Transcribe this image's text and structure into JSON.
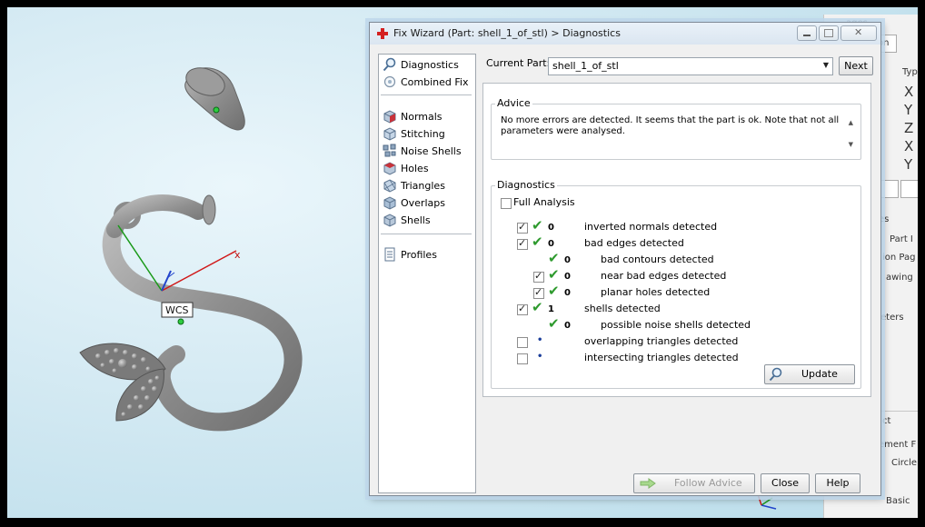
{
  "dialog": {
    "title": "Fix Wizard (Part: shell_1_of_stl) > Diagnostics",
    "current_part_label": "Current Part:",
    "current_part_value": "shell_1_of_stl",
    "next_label": "Next"
  },
  "nav": {
    "top": [
      {
        "label": "Diagnostics",
        "icon": "magnifier-icon"
      },
      {
        "label": "Combined Fix",
        "icon": "combined-fix-icon"
      }
    ],
    "tools": [
      {
        "label": "Normals",
        "icon": "normals-cube-icon"
      },
      {
        "label": "Stitching",
        "icon": "stitching-cube-icon"
      },
      {
        "label": "Noise Shells",
        "icon": "noise-shells-icon"
      },
      {
        "label": "Holes",
        "icon": "holes-cube-icon"
      },
      {
        "label": "Triangles",
        "icon": "triangles-cube-icon"
      },
      {
        "label": "Overlaps",
        "icon": "overlaps-cube-icon"
      },
      {
        "label": "Shells",
        "icon": "shells-cube-icon"
      }
    ],
    "bottom": [
      {
        "label": "Profiles",
        "icon": "profiles-icon"
      }
    ]
  },
  "advice": {
    "label": "Advice",
    "text_line1": "No more errors are detected. It seems that the part is ok. Note that not all",
    "text_line2": "parameters were analysed."
  },
  "diagnostics": {
    "label": "Diagnostics",
    "full_analysis_label": "Full Analysis",
    "full_analysis_checked": false,
    "rows": [
      {
        "checked": true,
        "status": "ok",
        "count": "0",
        "label": "inverted normals detected",
        "indent": 0,
        "has_checkbox": true
      },
      {
        "checked": true,
        "status": "ok",
        "count": "0",
        "label": "bad edges detected",
        "indent": 0,
        "has_checkbox": true
      },
      {
        "checked": false,
        "status": "ok",
        "count": "0",
        "label": "bad contours detected",
        "indent": 1,
        "has_checkbox": false
      },
      {
        "checked": true,
        "status": "ok",
        "count": "0",
        "label": "near bad edges detected",
        "indent": 1,
        "has_checkbox": true
      },
      {
        "checked": true,
        "status": "ok",
        "count": "0",
        "label": "planar holes detected",
        "indent": 1,
        "has_checkbox": true
      },
      {
        "checked": true,
        "status": "ok",
        "count": "1",
        "label": "shells detected",
        "indent": 0,
        "has_checkbox": true
      },
      {
        "checked": false,
        "status": "ok",
        "count": "0",
        "label": "possible noise shells detected",
        "indent": 1,
        "has_checkbox": false
      },
      {
        "checked": false,
        "status": "pending",
        "count": "•",
        "label": "overlapping triangles detected",
        "indent": 0,
        "has_checkbox": true
      },
      {
        "checked": false,
        "status": "pending",
        "count": "•",
        "label": "intersecting triangles detected",
        "indent": 0,
        "has_checkbox": true
      }
    ],
    "update_label": "Update"
  },
  "footer": {
    "follow_advice_label": "Follow Advice",
    "close_label": "Close",
    "help_label": "Help"
  },
  "viewport": {
    "wcs_label": "WCS",
    "axis_x_label": "x",
    "axis_y_label": "y"
  },
  "background_panel": {
    "tab_label": "on",
    "heading_fragment": "ages",
    "type_fragment": "Typ",
    "coords": [
      "X",
      "Y",
      "Z",
      "X",
      "Y"
    ],
    "frag_es": "es",
    "frag_part": "Part I",
    "frag_ion_pag": "ion Pag",
    "frag_awing": "awing",
    "frag_eters": "eters",
    "frag_ct": "ct",
    "frag_ement": "ement F",
    "frag_circle": "Circle",
    "frag_basic": "Basic"
  },
  "colors": {
    "accent_check": "#2e9a2e",
    "viewport_bg": "#cfe7f1",
    "axis_x": "#d01818",
    "axis_y": "#1a9a1a",
    "axis_z": "#2244cc"
  }
}
